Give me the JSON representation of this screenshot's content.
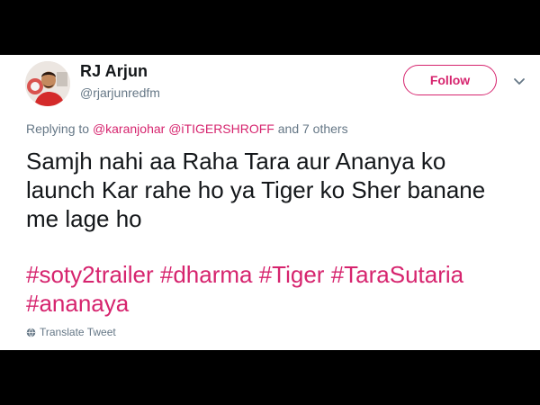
{
  "user": {
    "name": "RJ Arjun",
    "handle": "@rjarjunredfm"
  },
  "follow_label": "Follow",
  "reply": {
    "prefix": "Replying to",
    "mentions": [
      "@karanjohar",
      "@iTIGERSHROFF"
    ],
    "suffix": "and 7 others"
  },
  "tweet": {
    "lines": [
      "Samjh nahi aa Raha Tara aur Ananya ko",
      "launch Kar rahe ho ya Tiger ko Sher banane",
      "me lage ho"
    ],
    "hashtags": [
      "#soty2trailer",
      "#dharma",
      "#Tiger",
      "#TaraSutaria",
      "#ananaya"
    ]
  },
  "translate_label": "Translate Tweet",
  "colors": {
    "accent": "#d6246e",
    "text": "#14171a",
    "muted": "#657786",
    "frame": "#000000"
  },
  "icons": {
    "menu": "chevron-down-icon",
    "translate": "globe-icon"
  }
}
